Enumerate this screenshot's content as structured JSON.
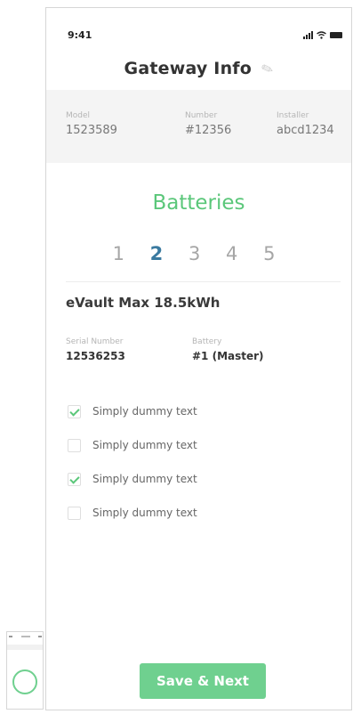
{
  "status_bar": {
    "time": "9:41"
  },
  "header": {
    "title": "Gateway Info"
  },
  "gateway": {
    "model_label": "Model",
    "model_value": "1523589",
    "number_label": "Number",
    "number_value": "#12356",
    "installer_label": "Installer",
    "installer_value": "abcd1234"
  },
  "batteries": {
    "title": "Batteries",
    "pages": [
      "1",
      "2",
      "3",
      "4",
      "5"
    ],
    "active_page": "2"
  },
  "battery_detail": {
    "product_name": "eVault Max 18.5kWh",
    "serial_label": "Serial Number",
    "serial_value": "12536253",
    "battery_label": "Battery",
    "battery_value": "#1 (Master)"
  },
  "checklist": [
    {
      "label": "Simply dummy text",
      "checked": true
    },
    {
      "label": "Simply dummy text",
      "checked": false
    },
    {
      "label": "Simply dummy text",
      "checked": true
    },
    {
      "label": "Simply dummy text",
      "checked": false
    }
  ],
  "footer": {
    "save_label": "Save & Next"
  },
  "colors": {
    "accent": "#5bc77a",
    "button": "#6fd08f",
    "active_page": "#3a7aa0"
  }
}
